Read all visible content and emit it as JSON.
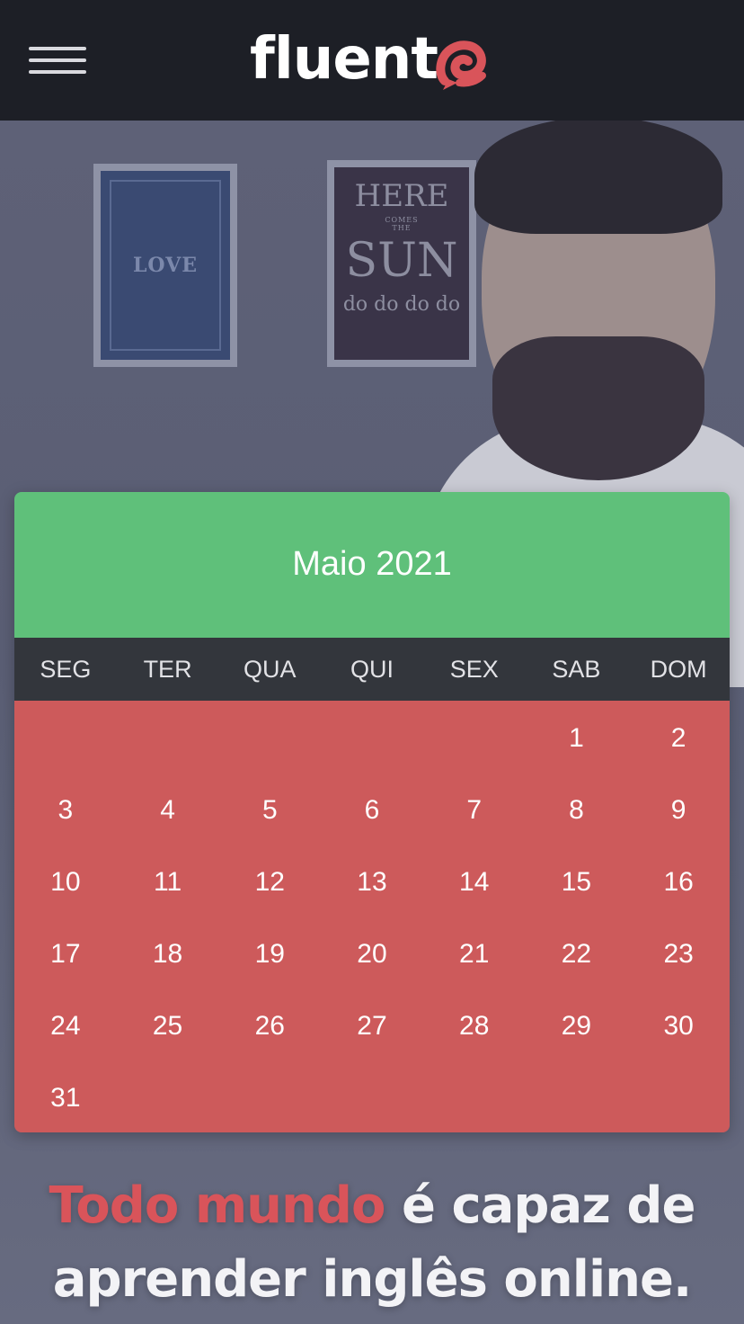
{
  "header": {
    "logo_text": "fluent",
    "menu_icon": "hamburger-menu-icon",
    "colors": {
      "background": "#1d1f26",
      "logo": "#ffffff",
      "logo_accent": "#d9545a"
    }
  },
  "hero": {
    "poster_left_text": "LOVE",
    "poster_right": {
      "line1": "HERE",
      "line2": "COMES",
      "line3": "THE",
      "line4": "SUN",
      "line5": "do do do do"
    }
  },
  "calendar": {
    "title": "Maio 2021",
    "weekdays": [
      "SEG",
      "TER",
      "QUA",
      "QUI",
      "SEX",
      "SAB",
      "DOM"
    ],
    "weeks": [
      [
        "",
        "",
        "",
        "",
        "",
        "1",
        "2"
      ],
      [
        "3",
        "4",
        "5",
        "6",
        "7",
        "8",
        "9"
      ],
      [
        "10",
        "11",
        "12",
        "13",
        "14",
        "15",
        "16"
      ],
      [
        "17",
        "18",
        "19",
        "20",
        "21",
        "22",
        "23"
      ],
      [
        "24",
        "25",
        "26",
        "27",
        "28",
        "29",
        "30"
      ],
      [
        "31",
        "",
        "",
        "",
        "",
        "",
        ""
      ]
    ],
    "colors": {
      "header": "#5fc07a",
      "weekday_bar": "#33363c",
      "days": "#cd5a5b"
    }
  },
  "headline": {
    "accent": "Todo mundo",
    "rest_line1": " é capaz de",
    "line2": "aprender inglês online."
  }
}
